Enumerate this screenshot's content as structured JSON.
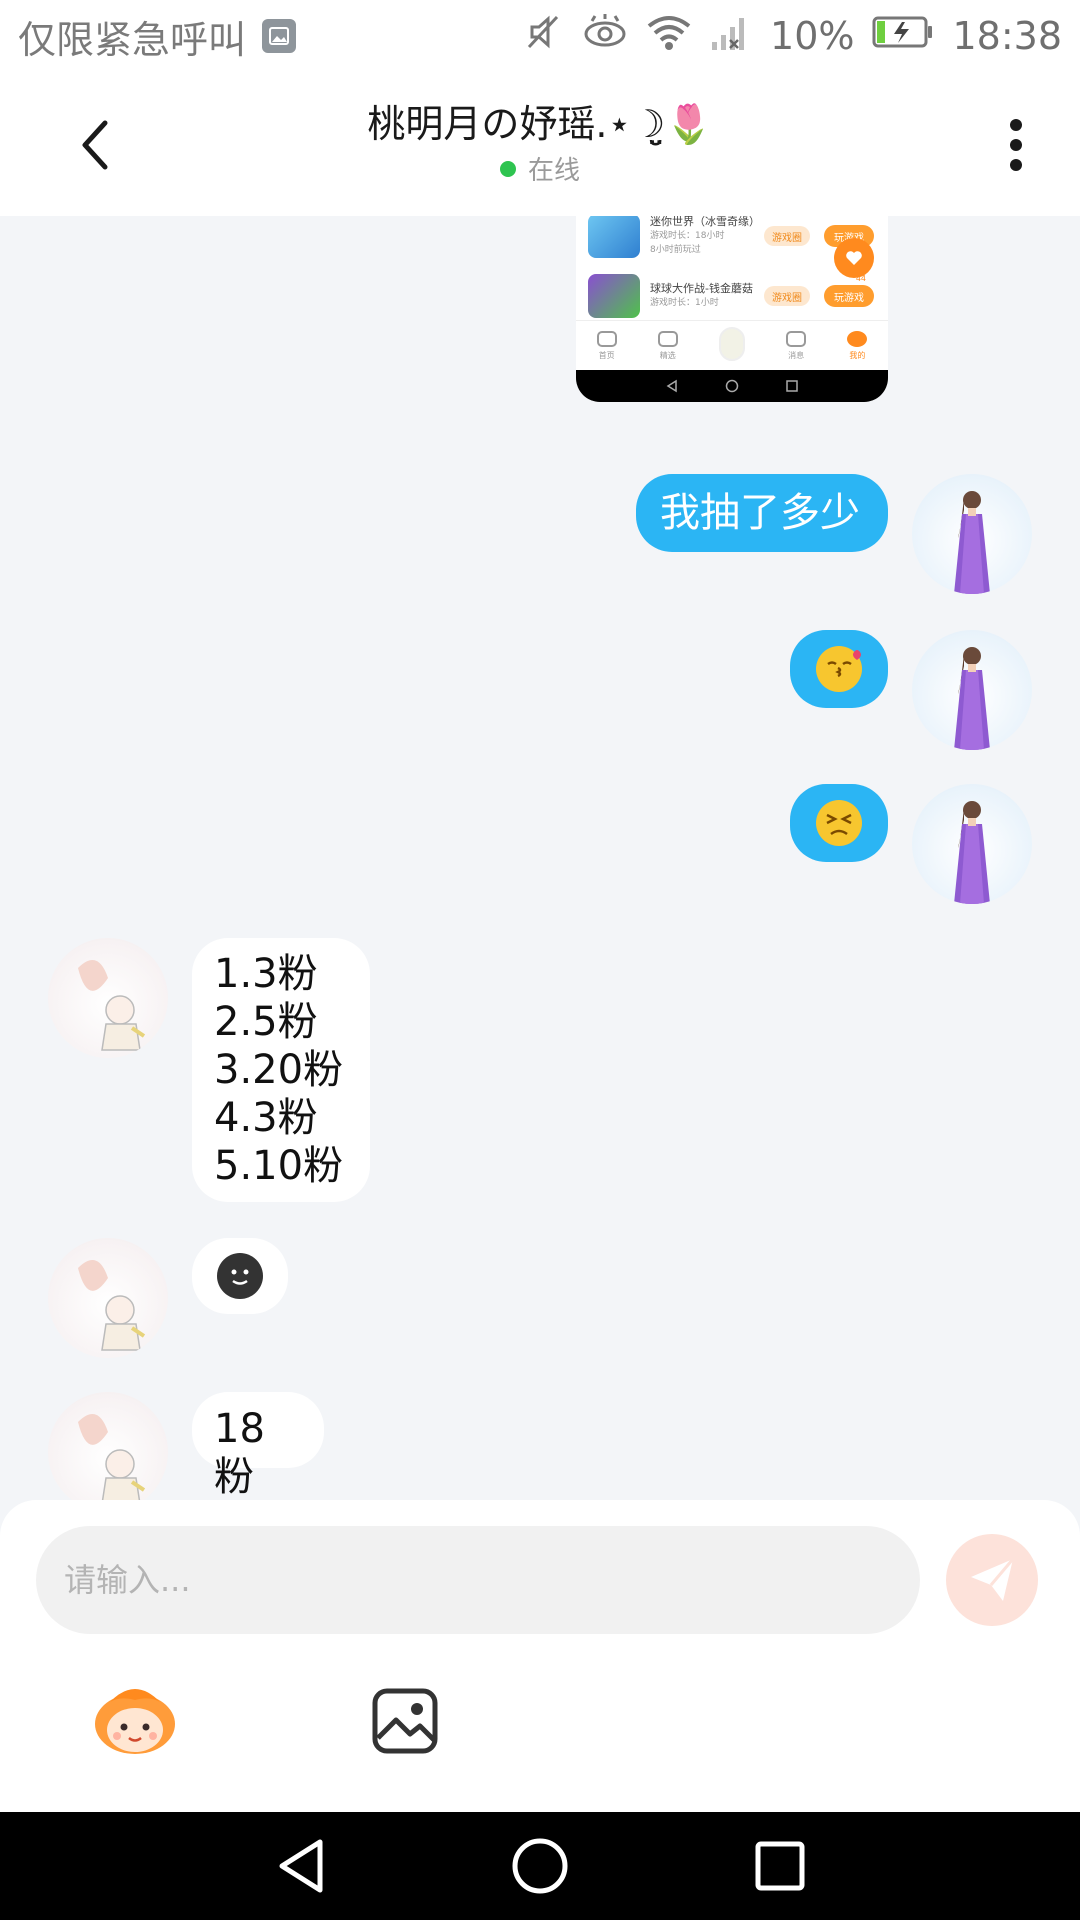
{
  "status_bar": {
    "carrier_text": "仅限紧急呼叫",
    "battery_percent": "10%",
    "time": "18:38"
  },
  "header": {
    "title": "桃明月の妤瑶.⋆☽̤̮🌷",
    "status": "在线"
  },
  "screenshot_message": {
    "rows": [
      {
        "title": "迷你世界（冰雪奇缘）",
        "sub1": "游戏时长：18小时",
        "sub2": "8小时前玩过",
        "tag": "游戏圈",
        "play": "玩游戏"
      },
      {
        "title": "球球大作战-钱金蘑菇",
        "sub1": "游戏时长：1小时",
        "sub2": "",
        "tag": "游戏圈",
        "play": "玩游戏"
      }
    ],
    "fab_count": "44",
    "tabs": [
      "首页",
      "精选",
      "",
      "消息",
      "我的"
    ]
  },
  "messages": [
    {
      "side": "out",
      "type": "text",
      "text": "我抽了多少"
    },
    {
      "side": "out",
      "type": "emoji",
      "emoji": "kiss-face"
    },
    {
      "side": "out",
      "type": "emoji",
      "emoji": "persevering-face"
    },
    {
      "side": "in",
      "type": "text",
      "lines": [
        "1.3粉",
        "2.5粉",
        "3.20粉",
        "4.3粉",
        "5.10粉"
      ]
    },
    {
      "side": "in",
      "type": "emoji",
      "emoji": "dark-smile-face"
    },
    {
      "side": "in",
      "type": "text",
      "text": "18粉"
    }
  ],
  "composer": {
    "placeholder": "请输入...",
    "send_color": "#fde2da"
  },
  "colors": {
    "outgoing_bubble": "#2bb5f4",
    "incoming_bubble": "#ffffff",
    "chat_background": "#f3f5f8",
    "online_dot": "#2ec450"
  }
}
